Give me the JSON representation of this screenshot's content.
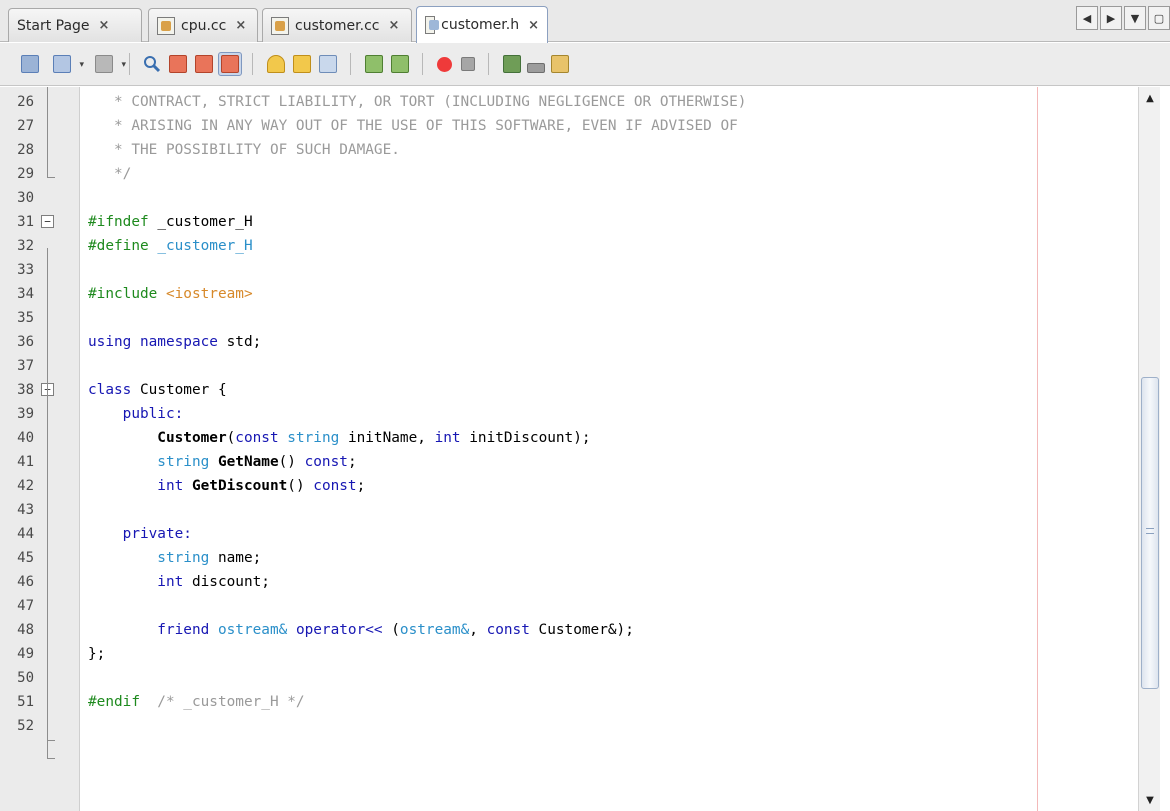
{
  "tabs": [
    {
      "label": "Start Page",
      "icon": "none",
      "active": false,
      "close": "×"
    },
    {
      "label": "cpu.cc",
      "icon": "cc-file-icon",
      "active": false,
      "close": "×"
    },
    {
      "label": "customer.cc",
      "icon": "cc-file-icon",
      "active": false,
      "close": "×"
    },
    {
      "label": "customer.h",
      "icon": "header-file-icon",
      "active": true,
      "close": "×"
    }
  ],
  "tab_nav": {
    "left": "◀",
    "right": "▶",
    "menu": "▼",
    "restore": "▢"
  },
  "toolbar": {
    "buttons": [
      "back-history-icon",
      "forward-history-dropdown-icon",
      "last-edit-dropdown-icon",
      "find-selection-icon",
      "find-previous-icon",
      "find-next-icon",
      "toggle-highlight-search-icon",
      "toggle-bookmark-icon",
      "previous-bookmark-icon",
      "next-bookmark-icon",
      "shift-left-icon",
      "shift-right-icon",
      "start-macro-icon",
      "stop-macro-icon",
      "comment-icon",
      "uncomment-icon",
      "diff-icon"
    ],
    "colors": {
      "find": "#d45a3c",
      "bookmark": "#e7b93a",
      "shift": "#5a8a3a",
      "macro_record": "#e83b3b",
      "macro_stop": "#8a8a8a",
      "history": "#5b7fb7"
    }
  },
  "editor": {
    "lines": [
      {
        "n": "26",
        "segs": [
          {
            "c": "cm",
            "t": "   * CONTRACT, STRICT LIABILITY, OR TORT (INCLUDING NEGLIGENCE OR OTHERWISE)"
          }
        ]
      },
      {
        "n": "27",
        "segs": [
          {
            "c": "cm",
            "t": "   * ARISING IN ANY WAY OUT OF THE USE OF THIS SOFTWARE, EVEN IF ADVISED OF"
          }
        ]
      },
      {
        "n": "28",
        "segs": [
          {
            "c": "cm",
            "t": "   * THE POSSIBILITY OF SUCH DAMAGE."
          }
        ]
      },
      {
        "n": "29",
        "segs": [
          {
            "c": "cm",
            "t": "   */"
          }
        ]
      },
      {
        "n": "30",
        "segs": []
      },
      {
        "n": "31",
        "segs": [
          {
            "c": "pp",
            "t": "#ifndef"
          },
          {
            "c": "pl",
            "t": " _customer_H"
          }
        ]
      },
      {
        "n": "32",
        "segs": [
          {
            "c": "pp",
            "t": "#define"
          },
          {
            "c": "df",
            "t": " _customer_H"
          }
        ]
      },
      {
        "n": "33",
        "segs": []
      },
      {
        "n": "34",
        "segs": [
          {
            "c": "pp",
            "t": "#include"
          },
          {
            "c": "str",
            "t": " <iostream>"
          }
        ]
      },
      {
        "n": "35",
        "segs": []
      },
      {
        "n": "36",
        "segs": [
          {
            "c": "kw",
            "t": "using namespace"
          },
          {
            "c": "pl",
            "t": " std;"
          }
        ]
      },
      {
        "n": "37",
        "segs": []
      },
      {
        "n": "38",
        "segs": [
          {
            "c": "kw",
            "t": "class"
          },
          {
            "c": "pl",
            "t": " Customer {"
          }
        ]
      },
      {
        "n": "39",
        "segs": [
          {
            "c": "kw",
            "t": "    public:"
          }
        ]
      },
      {
        "n": "40",
        "segs": [
          {
            "c": "fn",
            "t": "        Customer"
          },
          {
            "c": "pl",
            "t": "("
          },
          {
            "c": "kw",
            "t": "const"
          },
          {
            "c": "ty",
            "t": " string"
          },
          {
            "c": "pl",
            "t": " initName, "
          },
          {
            "c": "kw",
            "t": "int"
          },
          {
            "c": "pl",
            "t": " initDiscount);"
          }
        ]
      },
      {
        "n": "41",
        "segs": [
          {
            "c": "ty",
            "t": "        string"
          },
          {
            "c": "fn",
            "t": " GetName"
          },
          {
            "c": "pl",
            "t": "() "
          },
          {
            "c": "kw",
            "t": "const"
          },
          {
            "c": "pl",
            "t": ";"
          }
        ]
      },
      {
        "n": "42",
        "segs": [
          {
            "c": "kw",
            "t": "        int"
          },
          {
            "c": "fn",
            "t": " GetDiscount"
          },
          {
            "c": "pl",
            "t": "() "
          },
          {
            "c": "kw",
            "t": "const"
          },
          {
            "c": "pl",
            "t": ";"
          }
        ]
      },
      {
        "n": "43",
        "segs": []
      },
      {
        "n": "44",
        "segs": [
          {
            "c": "kw",
            "t": "    private:"
          }
        ]
      },
      {
        "n": "45",
        "segs": [
          {
            "c": "ty",
            "t": "        string"
          },
          {
            "c": "pl",
            "t": " name;"
          }
        ]
      },
      {
        "n": "46",
        "segs": [
          {
            "c": "kw",
            "t": "        int"
          },
          {
            "c": "pl",
            "t": " discount;"
          }
        ]
      },
      {
        "n": "47",
        "segs": []
      },
      {
        "n": "48",
        "segs": [
          {
            "c": "kw",
            "t": "        friend"
          },
          {
            "c": "ty",
            "t": " ostream&"
          },
          {
            "c": "kw",
            "t": " operator<<"
          },
          {
            "c": "pl",
            "t": " ("
          },
          {
            "c": "ty",
            "t": "ostream&"
          },
          {
            "c": "pl",
            "t": ", "
          },
          {
            "c": "kw",
            "t": "const"
          },
          {
            "c": "pl",
            "t": " Customer&);"
          }
        ]
      },
      {
        "n": "49",
        "segs": [
          {
            "c": "pl",
            "t": "};"
          }
        ]
      },
      {
        "n": "50",
        "segs": []
      },
      {
        "n": "51",
        "segs": [
          {
            "c": "pp",
            "t": "#endif"
          },
          {
            "c": "cm",
            "t": "  /* _customer_H */"
          }
        ]
      },
      {
        "n": "52",
        "segs": []
      }
    ],
    "fold_markers": [
      {
        "line": "31",
        "symbol": "−"
      },
      {
        "line": "38",
        "symbol": "−"
      }
    ]
  },
  "scrollbar": {
    "up": "▲",
    "down": "▼"
  }
}
